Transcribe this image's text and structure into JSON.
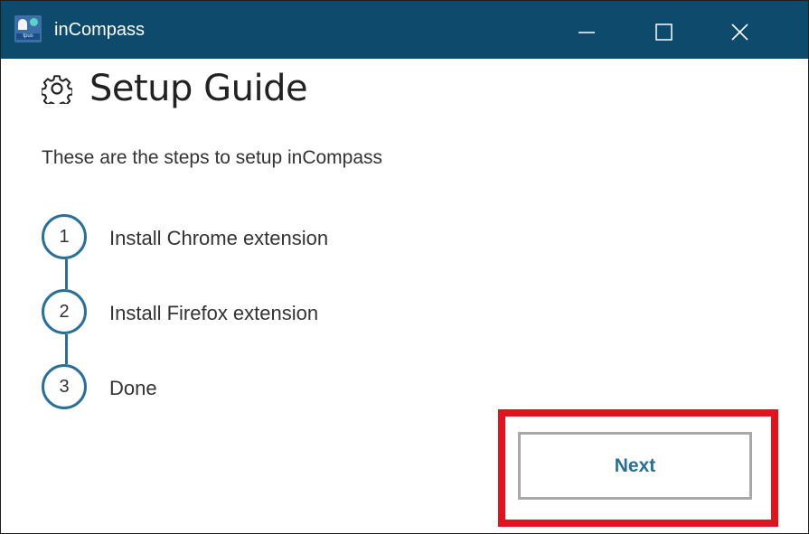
{
  "window": {
    "title": "inCompass",
    "app_icon_text": "tpus",
    "controls": [
      "minimize",
      "maximize",
      "close"
    ]
  },
  "header": {
    "icon": "gear-icon",
    "title": "Setup Guide"
  },
  "intro": "These are the steps to setup inCompass",
  "steps": [
    {
      "number": "1",
      "label": "Install Chrome extension"
    },
    {
      "number": "2",
      "label": "Install Firefox extension"
    },
    {
      "number": "3",
      "label": "Done"
    }
  ],
  "actions": {
    "next_label": "Next"
  },
  "colors": {
    "titlebar": "#0d4a6b",
    "accent": "#2a6f97",
    "highlight": "#e0141f"
  }
}
